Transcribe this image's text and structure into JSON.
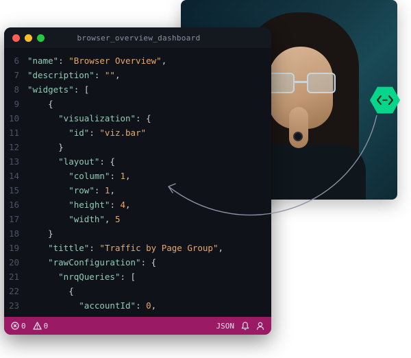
{
  "photo": {
    "alt": "Person with glasses looking at screen"
  },
  "editor": {
    "filename": "browser_overview_dashboard",
    "lines": [
      {
        "num": "6",
        "indent": 0,
        "parts": [
          {
            "t": "key",
            "v": "\"name\""
          },
          {
            "t": "punc",
            "v": ": "
          },
          {
            "t": "str",
            "v": "\"Browser Overview\""
          },
          {
            "t": "punc",
            "v": ","
          }
        ]
      },
      {
        "num": "7",
        "indent": 0,
        "parts": [
          {
            "t": "key",
            "v": "\"description\""
          },
          {
            "t": "punc",
            "v": ": "
          },
          {
            "t": "str",
            "v": "\"\""
          },
          {
            "t": "punc",
            "v": ","
          }
        ]
      },
      {
        "num": "8",
        "indent": 0,
        "parts": [
          {
            "t": "key",
            "v": "\"widgets\""
          },
          {
            "t": "punc",
            "v": ": ["
          }
        ]
      },
      {
        "num": "9",
        "indent": 2,
        "parts": [
          {
            "t": "punc",
            "v": "{"
          }
        ]
      },
      {
        "num": "10",
        "indent": 3,
        "parts": [
          {
            "t": "key",
            "v": "\"visualization\""
          },
          {
            "t": "punc",
            "v": ": {"
          }
        ]
      },
      {
        "num": "11",
        "indent": 4,
        "parts": [
          {
            "t": "key",
            "v": "\"id\""
          },
          {
            "t": "punc",
            "v": ": "
          },
          {
            "t": "str",
            "v": "\"viz.bar\""
          }
        ]
      },
      {
        "num": "12",
        "indent": 3,
        "parts": [
          {
            "t": "punc",
            "v": "}"
          }
        ]
      },
      {
        "num": "13",
        "indent": 3,
        "parts": [
          {
            "t": "key",
            "v": "\"layout\""
          },
          {
            "t": "punc",
            "v": ": {"
          }
        ]
      },
      {
        "num": "14",
        "indent": 4,
        "parts": [
          {
            "t": "key",
            "v": "\"column\""
          },
          {
            "t": "punc",
            "v": ": "
          },
          {
            "t": "num",
            "v": "1"
          },
          {
            "t": "punc",
            "v": ","
          }
        ]
      },
      {
        "num": "15",
        "indent": 4,
        "parts": [
          {
            "t": "key",
            "v": "\"row\""
          },
          {
            "t": "punc",
            "v": ": "
          },
          {
            "t": "num",
            "v": "1"
          },
          {
            "t": "punc",
            "v": ","
          }
        ]
      },
      {
        "num": "16",
        "indent": 4,
        "parts": [
          {
            "t": "key",
            "v": "\"height\""
          },
          {
            "t": "punc",
            "v": ": "
          },
          {
            "t": "num",
            "v": "4"
          },
          {
            "t": "punc",
            "v": ","
          }
        ]
      },
      {
        "num": "17",
        "indent": 4,
        "parts": [
          {
            "t": "key",
            "v": "\"width\""
          },
          {
            "t": "punc",
            "v": ", "
          },
          {
            "t": "num",
            "v": "5"
          }
        ]
      },
      {
        "num": "18",
        "indent": 2,
        "parts": [
          {
            "t": "punc",
            "v": "}"
          }
        ]
      },
      {
        "num": "19",
        "indent": 2,
        "parts": [
          {
            "t": "key",
            "v": "\"tittle\""
          },
          {
            "t": "punc",
            "v": ": "
          },
          {
            "t": "str",
            "v": "\"Traffic by Page Group\""
          },
          {
            "t": "punc",
            "v": ","
          }
        ]
      },
      {
        "num": "20",
        "indent": 2,
        "parts": [
          {
            "t": "key",
            "v": "\"rawConfiguration\""
          },
          {
            "t": "punc",
            "v": ": {"
          }
        ]
      },
      {
        "num": "21",
        "indent": 3,
        "parts": [
          {
            "t": "key",
            "v": "\"nrqQueries\""
          },
          {
            "t": "punc",
            "v": ": ["
          }
        ]
      },
      {
        "num": "22",
        "indent": 4,
        "parts": [
          {
            "t": "punc",
            "v": "{"
          }
        ]
      },
      {
        "num": "23",
        "indent": 5,
        "parts": [
          {
            "t": "key",
            "v": "\"accountId\""
          },
          {
            "t": "punc",
            "v": ": "
          },
          {
            "t": "num",
            "v": "0"
          },
          {
            "t": "punc",
            "v": ","
          }
        ]
      }
    ]
  },
  "statusbar": {
    "errors": "0",
    "warnings": "0",
    "language": "JSON"
  },
  "badge": {
    "label": "code-share"
  }
}
